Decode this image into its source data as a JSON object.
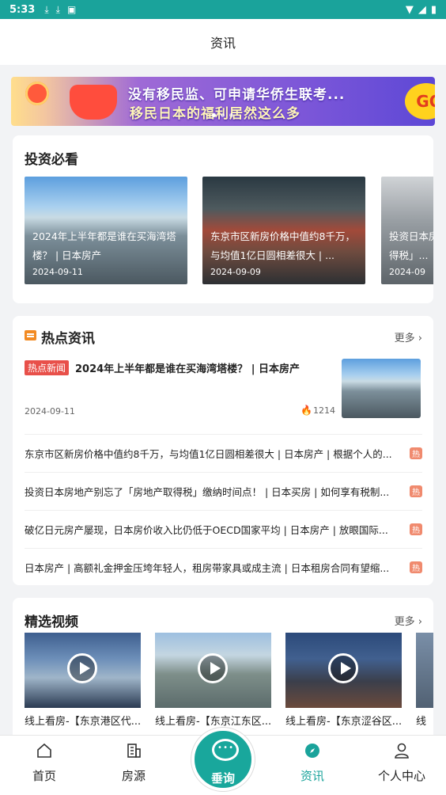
{
  "status_bar": {
    "time": "5:33"
  },
  "header": {
    "title": "资讯"
  },
  "banner": {
    "line1": "没有移民监、可申请华侨生联考...",
    "line2": "移民日本的福利居然这么多",
    "badge": "GO"
  },
  "invest": {
    "title": "投资必看",
    "items": [
      {
        "title": "2024年上半年都是谁在买海湾塔楼？ | 日本房产",
        "date": "2024-09-11"
      },
      {
        "title": "东京市区新房价格中值约8千万，与均值1亿日圆相差很大 | ...",
        "date": "2024-09-09"
      },
      {
        "title": "投资日本房地产别忘了「房地产取得税」...",
        "date": "2024-09"
      }
    ]
  },
  "hot": {
    "title": "热点资讯",
    "more": "更多",
    "featured": {
      "tag": "热点新闻",
      "title": "2024年上半年都是谁在买海湾塔楼？ | 日本房产",
      "date": "2024-09-11",
      "views": "1214"
    },
    "rows": [
      {
        "title": "东京市区新房价格中值约8千万，与均值1亿日圆相差很大 | 日本房产 | 根据个人的...",
        "badge": "热"
      },
      {
        "title": "投资日本房地产别忘了「房地产取得税」缴纳时间点！ | 日本买房 | 如何享有税制...",
        "badge": "热"
      },
      {
        "title": "破亿日元房产屡现，日本房价收入比仍低于OECD国家平均 | 日本房产 | 放眼国际...",
        "badge": "热"
      },
      {
        "title": "日本房产 | 高额礼金押金压垮年轻人，租房带家具或成主流 | 日本租房合同有望缩...",
        "badge": "热"
      }
    ]
  },
  "videos": {
    "title": "精选视频",
    "more": "更多",
    "items": [
      {
        "title": "线上看房-【东京港区代..."
      },
      {
        "title": "线上看房-【东京江东区..."
      },
      {
        "title": "线上看房-【东京涩谷区..."
      },
      {
        "title": "线"
      }
    ]
  },
  "tabbar": {
    "items": [
      {
        "label": "首页"
      },
      {
        "label": "房源"
      },
      {
        "label": "垂询"
      },
      {
        "label": "资讯"
      },
      {
        "label": "个人中心"
      }
    ],
    "active": "资讯",
    "accent": "#1aa39b"
  }
}
